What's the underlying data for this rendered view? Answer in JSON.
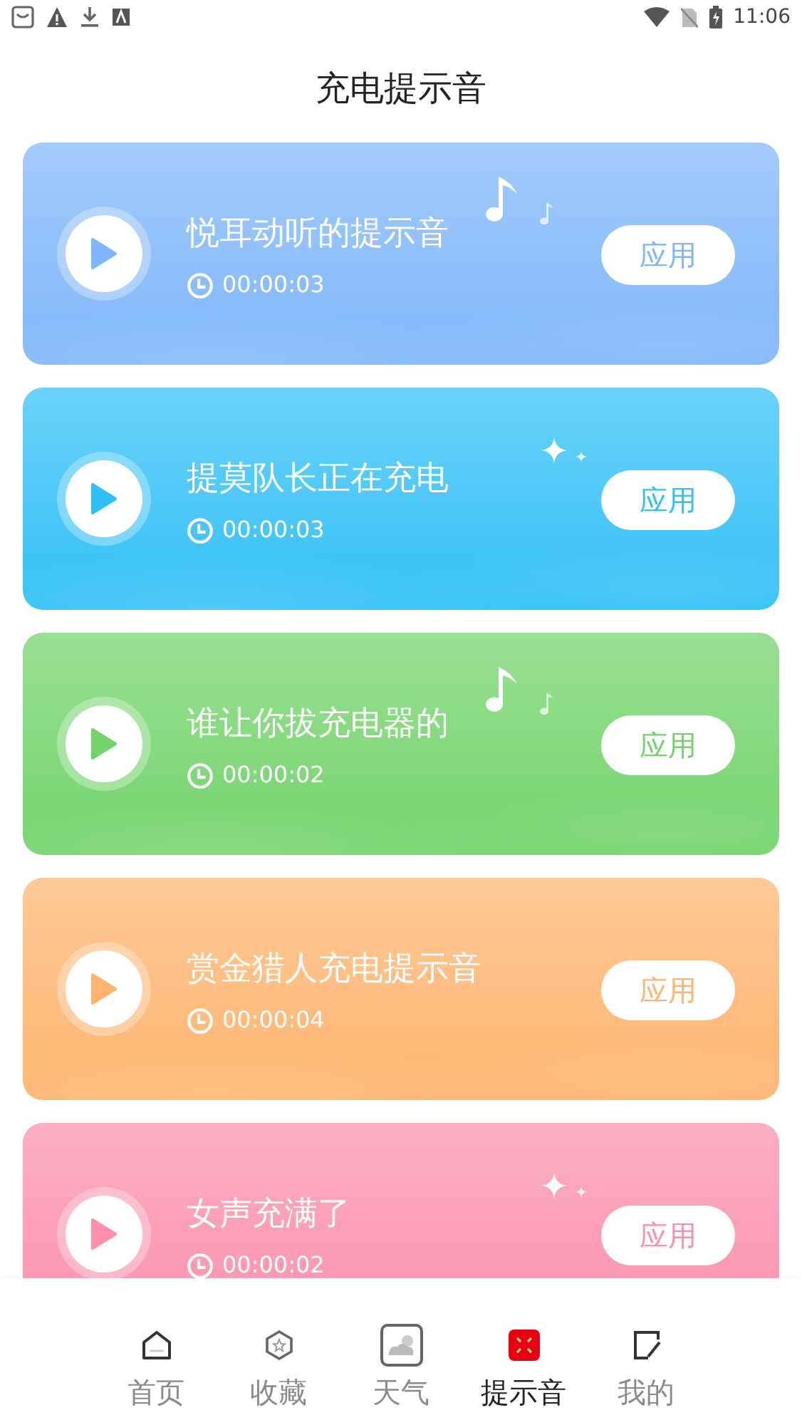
{
  "status_bar": {
    "time": "11:06"
  },
  "title": "充电提示音",
  "sounds": [
    {
      "title": "悦耳动听的提示音",
      "duration": "00:00:03",
      "button": "应用",
      "color": "#7fb6fb",
      "kind": "notes"
    },
    {
      "title": "提莫队长正在充电",
      "duration": "00:00:03",
      "button": "应用",
      "color": "#2ec0f7",
      "kind": "sparkles"
    },
    {
      "title": "谁让你拔充电器的",
      "duration": "00:00:02",
      "button": "应用",
      "color": "#72d36a",
      "kind": "notes"
    },
    {
      "title": "赏金猎人充电提示音",
      "duration": "00:00:04",
      "button": "应用",
      "color": "#feb46e",
      "kind": "plain"
    },
    {
      "title": "女声充满了",
      "duration": "00:00:02",
      "button": "应用",
      "color": "#fb8fac",
      "kind": "sparkles"
    }
  ],
  "nav": [
    {
      "label": "首页",
      "selected": false
    },
    {
      "label": "收藏",
      "selected": false
    },
    {
      "label": "天气",
      "selected": false
    },
    {
      "label": "提示音",
      "selected": true
    },
    {
      "label": "我的",
      "selected": false
    }
  ]
}
